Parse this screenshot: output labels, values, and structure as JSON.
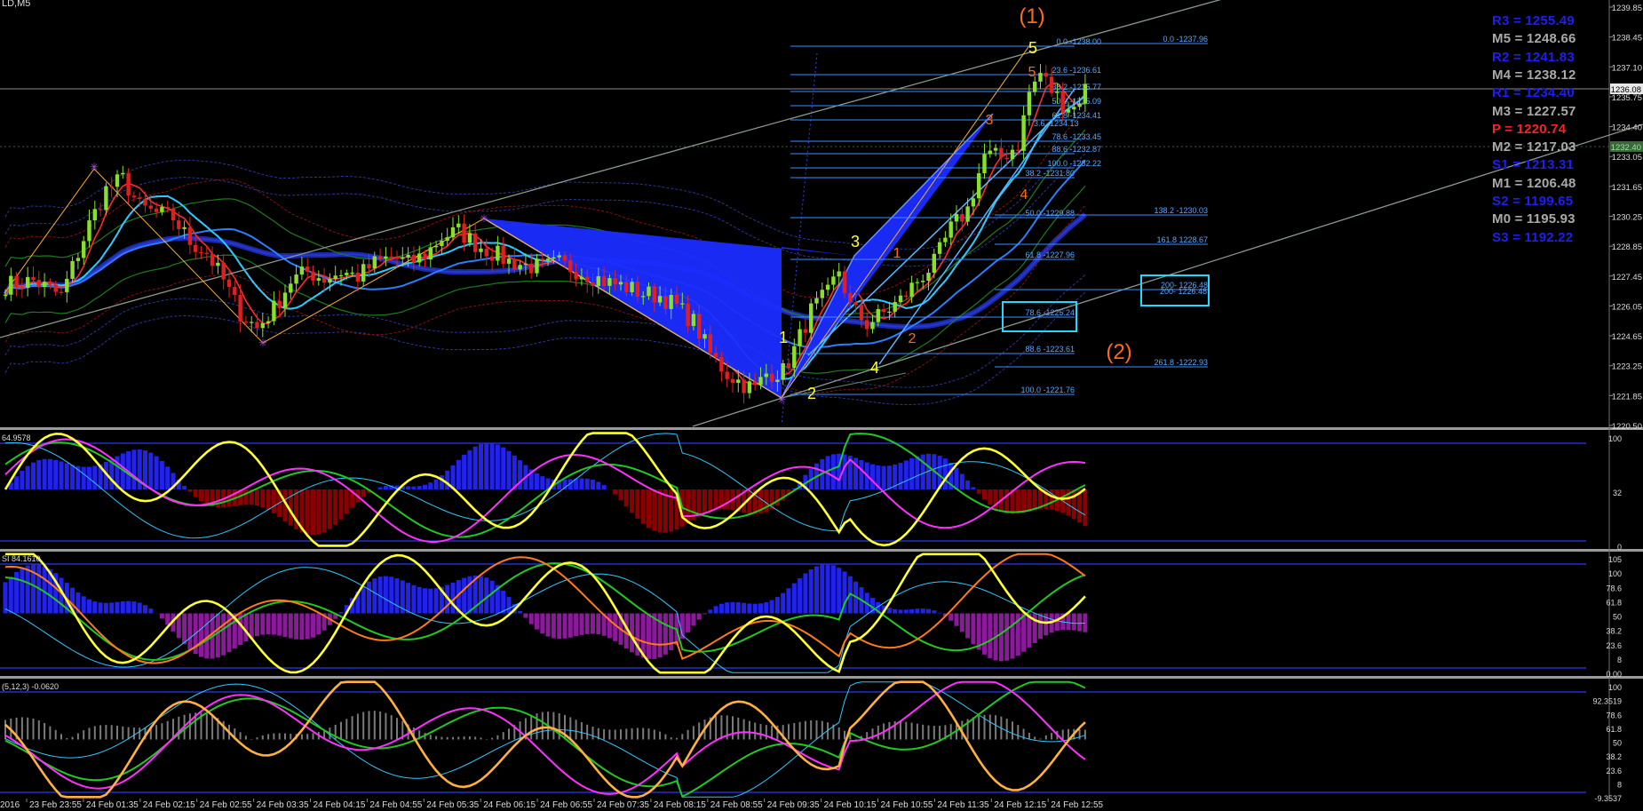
{
  "window": {
    "symbol_label": "LD,M5"
  },
  "colors": {
    "background": "#000000",
    "grid": "#1a2a3a",
    "axis_text": "#dcdcdc",
    "bull": "#88e02a",
    "bear": "#e02020",
    "harmonic_fill": "#1a2cff",
    "fib": "#3d8dff",
    "yellow": "#ffff33",
    "orange": "#ff6a1a",
    "cyan": "#22d8ff",
    "blue_hist": "#2222ee",
    "red_hist": "#8b0000",
    "purple_hist": "#8a1a9a"
  },
  "chart_data": [
    {
      "type": "candlestick",
      "panel": "main",
      "ylim": [
        1220.5,
        1239.85
      ],
      "y_ticks": [
        "1239.85",
        "1238.45",
        "1237.10",
        "1235.75",
        "1234.40",
        "1233.05",
        "1231.65",
        "1230.25",
        "1228.85",
        "1227.45",
        "1226.05",
        "1224.65",
        "1223.25",
        "1221.85",
        "1220.50"
      ],
      "current_price_tag": "1236.08",
      "bid_tag": "1232.40",
      "x_ticks": [
        "2016",
        "23 Feb 23:55",
        "24 Feb 01:35",
        "24 Feb 02:15",
        "24 Feb 02:55",
        "24 Feb 03:35",
        "24 Feb 04:15",
        "24 Feb 04:55",
        "24 Feb 05:35",
        "24 Feb 06:15",
        "24 Feb 06:55",
        "24 Feb 07:35",
        "24 Feb 08:15",
        "24 Feb 08:55",
        "24 Feb 09:35",
        "24 Feb 10:15",
        "24 Feb 10:55",
        "24 Feb 11:35",
        "24 Feb 12:15",
        "24 Feb 12:55"
      ],
      "close_path": [
        [
          0,
          1227.0
        ],
        [
          5,
          1227.2
        ],
        [
          10,
          1226.5
        ],
        [
          15,
          1229.8
        ],
        [
          18,
          1231.4
        ],
        [
          21,
          1231.9
        ],
        [
          24,
          1230.6
        ],
        [
          27,
          1230.3
        ],
        [
          30,
          1230.1
        ],
        [
          33,
          1229.0
        ],
        [
          36,
          1228.5
        ],
        [
          39,
          1227.2
        ],
        [
          42,
          1225.7
        ],
        [
          45,
          1225.0
        ],
        [
          48,
          1225.9
        ],
        [
          51,
          1227.2
        ],
        [
          54,
          1227.6
        ],
        [
          57,
          1227.3
        ],
        [
          60,
          1227.6
        ],
        [
          63,
          1227.4
        ],
        [
          66,
          1228.0
        ],
        [
          69,
          1228.3
        ],
        [
          72,
          1228.0
        ],
        [
          75,
          1228.4
        ],
        [
          78,
          1229.2
        ],
        [
          81,
          1229.5
        ],
        [
          84,
          1228.9
        ],
        [
          87,
          1228.5
        ],
        [
          90,
          1228.1
        ],
        [
          93,
          1227.9
        ],
        [
          96,
          1227.8
        ],
        [
          99,
          1228.0
        ],
        [
          102,
          1227.7
        ],
        [
          105,
          1227.4
        ],
        [
          108,
          1227.1
        ],
        [
          111,
          1226.9
        ],
        [
          114,
          1226.6
        ],
        [
          117,
          1226.5
        ],
        [
          120,
          1226.0
        ],
        [
          123,
          1225.3
        ],
        [
          126,
          1223.8
        ],
        [
          129,
          1222.9
        ],
        [
          132,
          1222.4
        ],
        [
          134,
          1222.2
        ],
        [
          136,
          1222.9
        ],
        [
          139,
          1223.0
        ],
        [
          141,
          1224.0
        ],
        [
          144,
          1225.8
        ],
        [
          147,
          1226.6
        ],
        [
          149,
          1227.7
        ],
        [
          151,
          1226.0
        ],
        [
          154,
          1225.2
        ],
        [
          157,
          1225.7
        ],
        [
          160,
          1226.3
        ],
        [
          163,
          1227.2
        ],
        [
          166,
          1228.0
        ],
        [
          169,
          1229.6
        ],
        [
          172,
          1230.5
        ],
        [
          175,
          1233.0
        ],
        [
          178,
          1232.9
        ],
        [
          181,
          1233.5
        ],
        [
          183,
          1235.9
        ],
        [
          185,
          1236.8
        ],
        [
          187,
          1236.0
        ],
        [
          189,
          1235.4
        ],
        [
          191,
          1235.2
        ],
        [
          193,
          1236.1
        ]
      ],
      "fibonacci_levels": [
        "0.0 -1238.00",
        "23.6 -1236.61",
        "38.2 -1235.77",
        "50.0 -1235.09",
        "61.8 -1234.41",
        "78.6 -1233.45",
        "88.6 -1232.87",
        "100.0 -1232.22",
        "0.0 -1237.96",
        "38.2 -1231.80",
        "50.0 -1229.88",
        "61.8 -1227.96",
        "78.6 -1225.24",
        "88.6 -1223.61",
        "100.0 -1221.76",
        "138.2 -1230.03",
        "161.8 1228.67",
        "200- 1226.48",
        "261.8 -1222.93",
        "3.6 -1234.13"
      ],
      "wave_labels": [
        "(1)",
        "(2)",
        "1",
        "2",
        "3",
        "4",
        "5",
        "1",
        "2",
        "3",
        "4",
        "5"
      ],
      "pivots": [
        {
          "label": "R3 = 1255.49",
          "color": "#1e1ef0"
        },
        {
          "label": "M5 = 1248.66",
          "color": "#a9a9a9"
        },
        {
          "label": "R2 = 1241.83",
          "color": "#1e1ef0"
        },
        {
          "label": "M4 = 1238.12",
          "color": "#a9a9a9"
        },
        {
          "label": "R1 = 1234.40",
          "color": "#1e1ef0"
        },
        {
          "label": "M3 = 1227.57",
          "color": "#a9a9a9"
        },
        {
          "label": "P   = 1220.74",
          "color": "#ff2020"
        },
        {
          "label": "M2 = 1217.03",
          "color": "#a9a9a9"
        },
        {
          "label": "S1 = 1213.31",
          "color": "#1e1ef0"
        },
        {
          "label": "M1 = 1206.48",
          "color": "#a9a9a9"
        },
        {
          "label": "S2 = 1199.65",
          "color": "#1e1ef0"
        },
        {
          "label": "M0 = 1195.93",
          "color": "#a9a9a9"
        },
        {
          "label": "S3 = 1192.22",
          "color": "#1e1ef0"
        }
      ]
    },
    {
      "type": "oscillator",
      "panel": "osc1",
      "header": "64.9578",
      "ylim": [
        0,
        100
      ],
      "y_ticks": [
        "100",
        "32",
        "0"
      ]
    },
    {
      "type": "oscillator",
      "panel": "osc2",
      "header": "SI 84.1610",
      "ylim": [
        0,
        100
      ],
      "y_ticks": [
        "105",
        "100",
        "78.6",
        "61.8",
        "50",
        "38.2",
        "23.6",
        "8",
        "0.00"
      ]
    },
    {
      "type": "oscillator",
      "panel": "osc3",
      "header": "(5,12,3) -0.0620",
      "ylim": [
        -10,
        100
      ],
      "y_ticks": [
        "100",
        "92.3519",
        "78.6",
        "61.8",
        "50",
        "38.2",
        "23.6",
        "8",
        "-9.3537"
      ]
    }
  ]
}
